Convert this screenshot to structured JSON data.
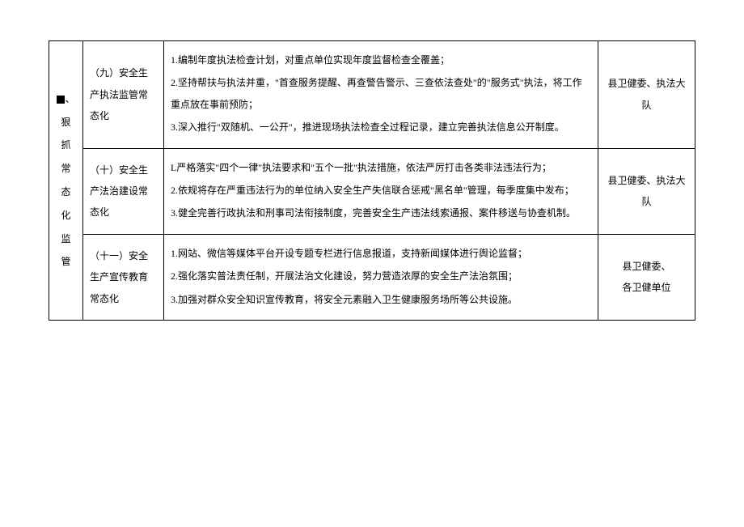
{
  "category": {
    "marker": "■",
    "label_suffix": "、",
    "text": "狠抓常态化监管"
  },
  "rows": [
    {
      "subitem": "（九）安全生产执法监管常态化",
      "contents": [
        "1.编制年度执法检查计划，对重点单位实现年度监督检查全覆盖；",
        "2.坚持帮扶与执法并重，\"首查服务提醒、再查警告警示、三查依法查处\"的\"服务式\"执法，将工作重点放在事前预防；",
        "3.深入推行\"双随机、一公开\"，推进现场执法检查全过程记录，建立完善执法信息公开制度。"
      ],
      "dept": "县卫健委、执法大队"
    },
    {
      "subitem": "（十）安全生产法治建设常态化",
      "contents": [
        "L严格落实\"四个一律\"执法要求和\"五个一批\"执法措施，依法严厉打击各类非法违法行为；",
        "2.依规将存在严重违法行为的单位纳入安全生产失信联合惩戒\"黑名单\"管理，每季度集中发布；",
        "3.健全完善行政执法和刑事司法衔接制度，完善安全生产违法线索通报、案件移送与协查机制。"
      ],
      "dept": "县卫健委、执法大队"
    },
    {
      "subitem": "（十一）安全生产宣传教育常态化",
      "contents": [
        "1.网站、微信等媒体平台开设专题专栏进行信息报道，支持新闻媒体进行舆论监督；",
        "2.强化落实普法责任制，开展法治文化建设，努力营造浓厚的安全生产法治氛围；",
        "3.加强对群众安全知识宣传教育，将安全元素融入卫生健康服务场所等公共设施。"
      ],
      "dept": "县卫健委、各卫健单位",
      "dept_multiline": true
    }
  ]
}
